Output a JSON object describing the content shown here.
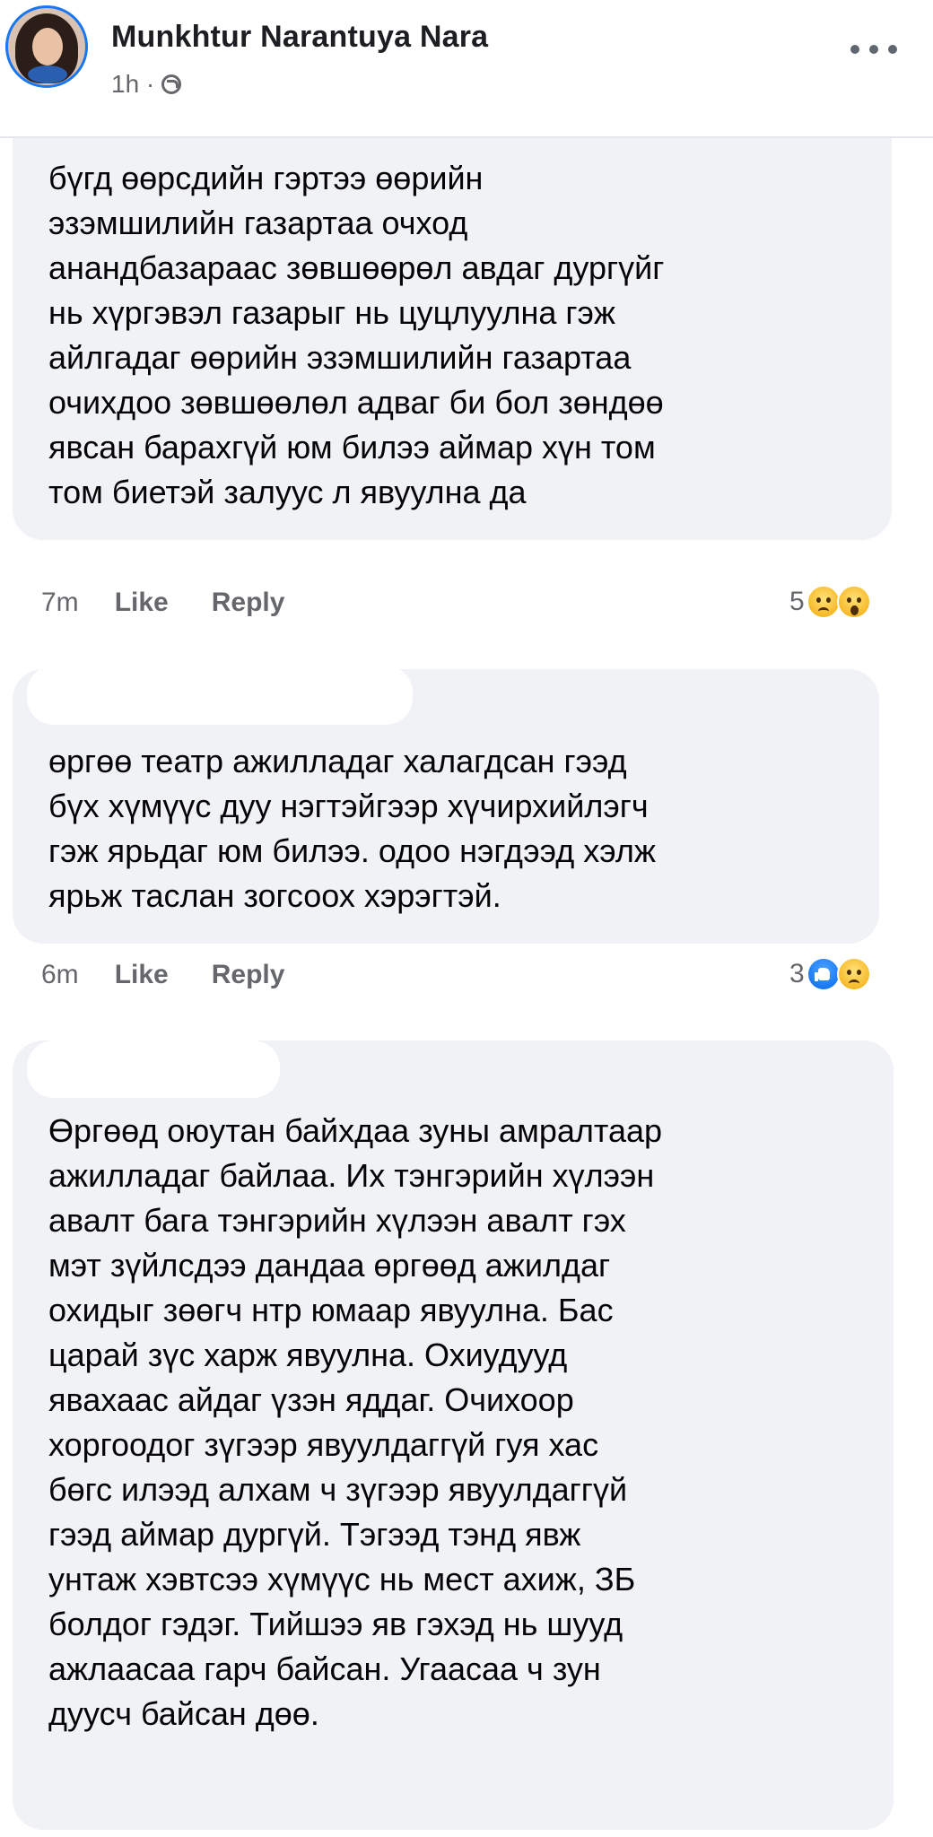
{
  "post": {
    "author_name": "Munkhtur Narantuya Nara",
    "time": "1h ·",
    "globe_icon": "globe-icon",
    "more_icon": "more-options-icon"
  },
  "comments": [
    {
      "text": "бүгд өөрсдийн гэртээ өөрийн\nэзэмшилийн газартаа очход\nанандбазараас зөвшөөрөл авдаг дургүйг\nнь хүргэвэл газарыг нь цуцлуулна гэж\nайлгадаг өөрийн эзэмшилийн газартаа\nочихдоо зөвшөөлөл адваг би бол зөндөө\nявсан барахгүй юм билээ аймар хүн том\nтом биетэй залуус л явуулна да",
      "time": "7m",
      "like_label": "Like",
      "reply_label": "Reply",
      "reaction_count": "5",
      "reactions": [
        "sad",
        "wow"
      ]
    },
    {
      "text": "өргөө театр ажилладаг халагдсан гээд\nбүх хүмүүс дуу нэгтэйгээр хүчирхийлэгч\nгэж ярьдаг юм билээ. одоо нэгдээд хэлж\nярьж таслан зогсоох хэрэгтэй.",
      "time": "6m",
      "like_label": "Like",
      "reply_label": "Reply",
      "reaction_count": "3",
      "reactions": [
        "like",
        "sad"
      ]
    },
    {
      "text": "Өргөөд оюутан байхдаа  зуны амралтаар\nажилладаг байлаа. Их тэнгэрийн хүлээн\nавалт бага тэнгэрийн хүлээн авалт гэх\nмэт зүйлсдээ дандаа өргөөд ажилдаг\nохидыг зөөгч нтр юмаар явуулна. Бас\nцарай зүс харж явуулна. Охиудууд\nявахаас айдаг үзэн яддаг. Очихоор\nхоргоодог зүгээр явуулдаггүй гуя хас\nбөгс илээд алхам ч зүгээр явуулдаггүй\nгээд аймар дургүй. Тэгээд тэнд явж\nунтаж хэвтсээ хүмүүс нь мест ахиж, ЗБ\nболдог гэдэг. Тийшээ яв гэхэд нь шууд\nажлаасаа гарч байсан. Угаасаа ч зун\nдуусч байсан дөө."
    }
  ]
}
